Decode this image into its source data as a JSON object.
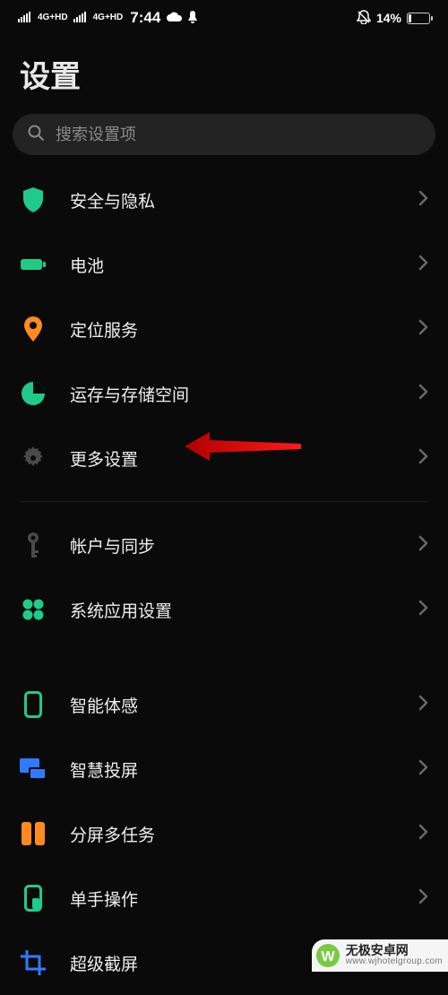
{
  "statusbar": {
    "net1": "4G+HD",
    "net2": "4G+HD",
    "time": "7:44",
    "battery_pct": "14%"
  },
  "page_title": "设置",
  "search": {
    "placeholder": "搜索设置项"
  },
  "groups": [
    [
      {
        "icon": "shield",
        "color": "#1ecb8b",
        "label": "安全与隐私"
      },
      {
        "icon": "battery",
        "color": "#1ecb8b",
        "label": "电池"
      },
      {
        "icon": "pin",
        "color": "#ff8a1f",
        "label": "定位服务"
      },
      {
        "icon": "pie",
        "color": "#1ecb8b",
        "label": "运存与存储空间"
      },
      {
        "icon": "gear",
        "color": "#4a4a4a",
        "label": "更多设置"
      }
    ],
    [
      {
        "icon": "key",
        "color": "#4a4a4a",
        "label": "帐户与同步"
      },
      {
        "icon": "clover",
        "color": "#1ecb8b",
        "label": "系统应用设置"
      }
    ],
    [
      {
        "icon": "phone-outline",
        "color": "#1ecb8b",
        "label": "智能体感"
      },
      {
        "icon": "cast",
        "color": "#2f7bff",
        "label": "智慧投屏"
      },
      {
        "icon": "split",
        "color": "#ff8a1f",
        "label": "分屏多任务"
      },
      {
        "icon": "onehand",
        "color": "#1ecb8b",
        "label": "单手操作"
      },
      {
        "icon": "crop",
        "color": "#2f7bff",
        "label": "超级截屏"
      }
    ]
  ],
  "watermark": {
    "title": "无极安卓网",
    "sub": "www.wjhotelgroup.com"
  }
}
